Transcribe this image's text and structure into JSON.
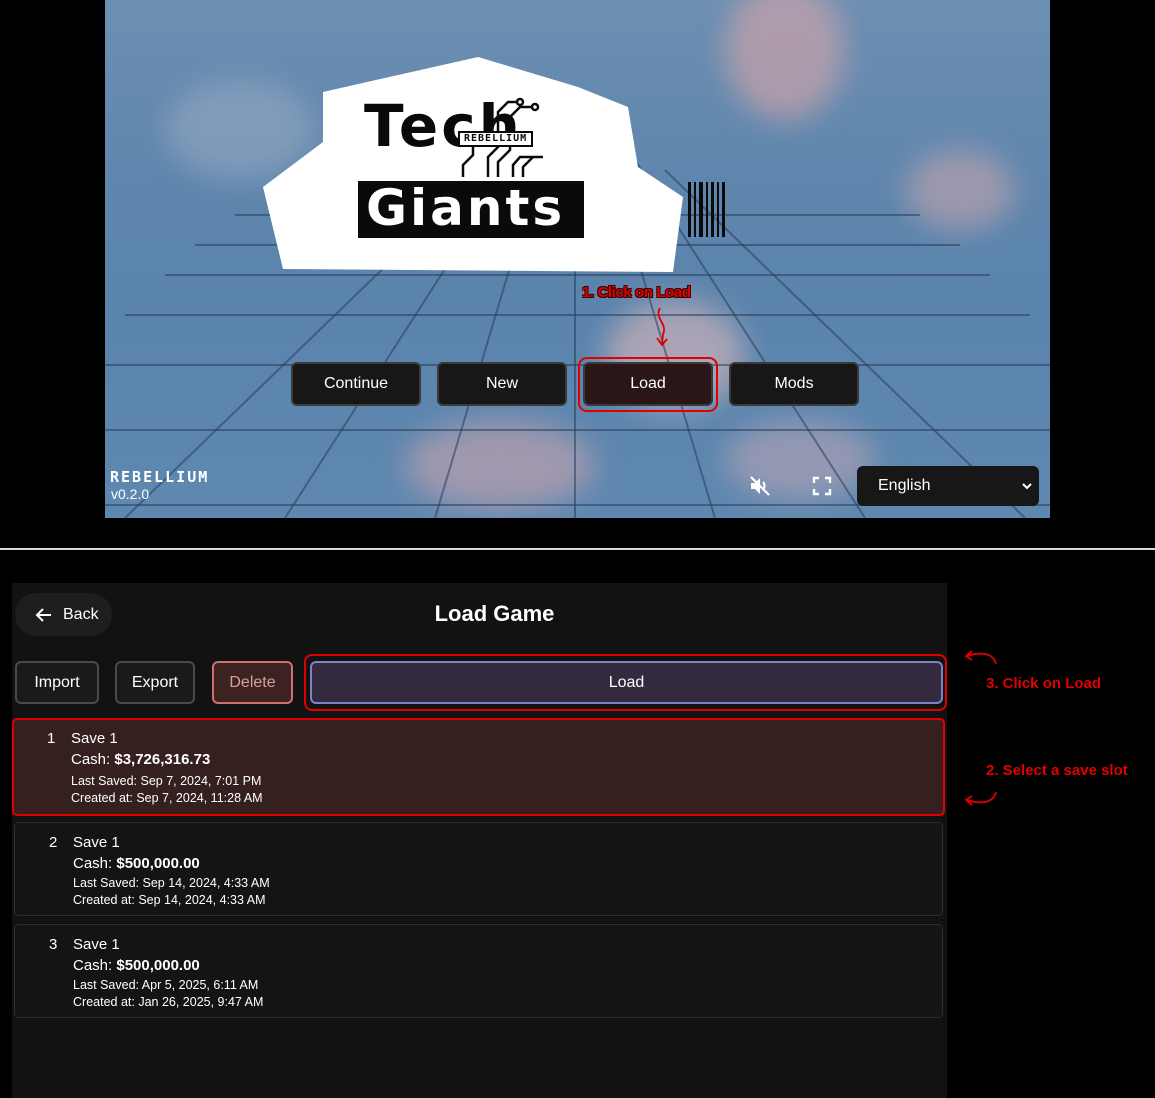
{
  "main_menu": {
    "logo": {
      "line1": "Tech",
      "badge": "REBELLIUM",
      "line2": "Giants"
    },
    "annotation": "1. Click on Load",
    "buttons": [
      {
        "label": "Continue"
      },
      {
        "label": "New"
      },
      {
        "label": "Load",
        "highlighted": true
      },
      {
        "label": "Mods"
      }
    ],
    "brand": "REBELLIUM",
    "version": "v0.2.0",
    "icons": {
      "mute": "volume-off-icon",
      "fullscreen": "fullscreen-icon"
    },
    "language": {
      "selected": "English"
    }
  },
  "load_game": {
    "back_label": "Back",
    "title": "Load Game",
    "actions": {
      "import": "Import",
      "export": "Export",
      "delete": "Delete",
      "load": "Load"
    },
    "slots": [
      {
        "index": "1",
        "name": "Save 1",
        "cash_label": "Cash:",
        "cash": "$3,726,316.73",
        "last_saved": "Last Saved: Sep 7, 2024, 7:01 PM",
        "created": "Created at: Sep 7, 2024, 11:28 AM",
        "selected": true
      },
      {
        "index": "2",
        "name": "Save 1",
        "cash_label": "Cash:",
        "cash": "$500,000.00",
        "last_saved": "Last Saved: Sep 14, 2024, 4:33 AM",
        "created": "Created at: Sep 14, 2024, 4:33 AM",
        "selected": false
      },
      {
        "index": "3",
        "name": "Save 1",
        "cash_label": "Cash:",
        "cash": "$500,000.00",
        "last_saved": "Last Saved: Apr 5, 2025, 6:11 AM",
        "created": "Created at: Jan 26, 2025, 9:47 AM",
        "selected": false
      }
    ],
    "annotations": {
      "load": "3. Click on Load",
      "select": "2. Select a save slot"
    }
  },
  "colors": {
    "annotation": "#e00000",
    "sky": "#5f86ad",
    "panel": "#121212",
    "selected_slot": "#361f1f",
    "load_button": "#332a40"
  }
}
